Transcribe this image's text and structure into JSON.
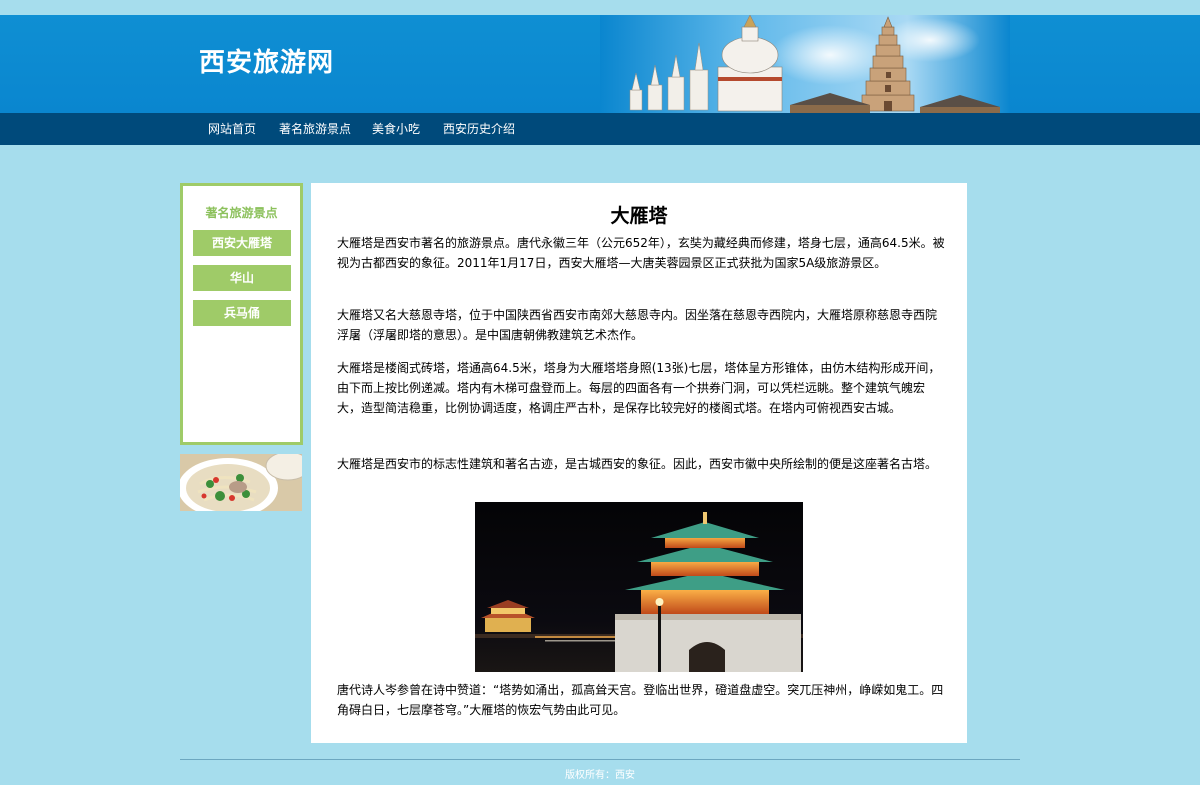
{
  "header": {
    "site_title": "西安旅游网",
    "banner_image": "xian-pagoda-banner"
  },
  "nav": {
    "items": [
      {
        "label": "网站首页"
      },
      {
        "label": "著名旅游景点"
      },
      {
        "label": "美食小吃"
      },
      {
        "label": "西安历史介绍"
      }
    ]
  },
  "sidebar": {
    "heading": "著名旅游景点",
    "items": [
      {
        "label": "西安大雁塔"
      },
      {
        "label": "华山"
      },
      {
        "label": "兵马俑"
      }
    ],
    "image": "noodle-bowl-photo"
  },
  "article": {
    "title": "大雁塔",
    "paragraphs": [
      "大雁塔是西安市著名的旅游景点。唐代永徽三年（公元652年），玄奘为藏经典而修建，塔身七层，通高64.5米。被视为古都西安的象征。2011年1月17日，西安大雁塔—大唐芙蓉园景区正式获批为国家5A级旅游景区。",
      "大雁塔又名大慈恩寺塔，位于中国陕西省西安市南郊大慈恩寺内。因坐落在慈恩寺西院内，大雁塔原称慈恩寺西院浮屠（浮屠即塔的意思）。是中国唐朝佛教建筑艺术杰作。",
      "大雁塔是楼阁式砖塔，塔通高64.5米，塔身为大雁塔塔身照(13张)七层，塔体呈方形锥体，由仿木结构形成开间，由下而上按比例递减。塔内有木梯可盘登而上。每层的四面各有一个拱券门洞，可以凭栏远眺。整个建筑气魄宏大，造型简洁稳重，比例协调适度，格调庄严古朴，是保存比较完好的楼阁式塔。在塔内可俯视西安古城。",
      "大雁塔是西安市的标志性建筑和著名古迹，是古城西安的象征。因此，西安市徽中央所绘制的便是这座著名古塔。",
      "唐代诗人岑参曾在诗中赞道：“塔势如涌出，孤高耸天宫。登临出世界，磴道盘虚空。突兀压神州，峥嵘如鬼工。四角碍白日，七层摩苍穹。”大雁塔的恢宏气势由此可见。"
    ],
    "photo": "bell-tower-night-photo"
  },
  "footer": {
    "copyright": "版权所有：西安"
  },
  "colors": {
    "page_bg": "#a6dded",
    "header_bg": "#0f8fd3",
    "nav_bg": "#004a7b",
    "sidebar_accent": "#9fcb68"
  }
}
